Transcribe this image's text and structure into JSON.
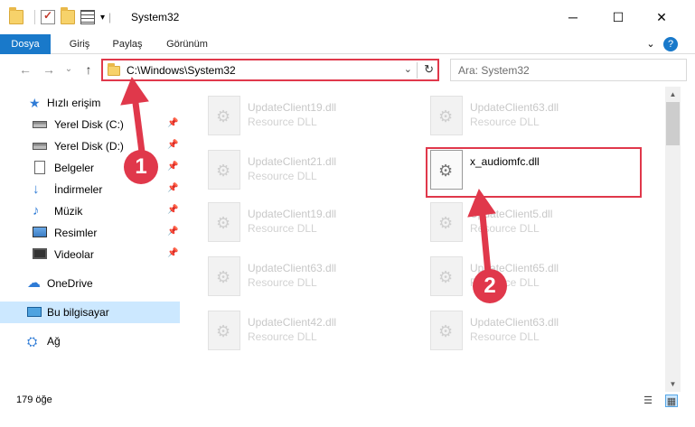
{
  "window": {
    "title": "System32",
    "minimize_glyph": "─",
    "maximize_glyph": "☐",
    "close_glyph": "✕",
    "qa_dropdown_glyph": "▾",
    "qa_separator": "|"
  },
  "ribbon": {
    "tabs": [
      "Dosya",
      "Giriş",
      "Paylaş",
      "Görünüm"
    ],
    "collapse_glyph": "⌄",
    "help_glyph": "?"
  },
  "nav": {
    "back": "←",
    "forward": "→",
    "recent": "⌄",
    "up": "↑",
    "address": "C:\\Windows\\System32",
    "address_dropdown": "⌄",
    "refresh": "↻",
    "search_placeholder": "Ara: System32"
  },
  "sidebar": {
    "pin_glyph": "📌",
    "items": [
      {
        "label": "Hızlı erişim",
        "icon": "star-icon",
        "glyph": "★"
      },
      {
        "label": "Yerel Disk (C:)",
        "icon": "drive-icon",
        "pinned": true
      },
      {
        "label": "Yerel Disk (D:)",
        "icon": "drive-icon",
        "pinned": true
      },
      {
        "label": "Belgeler",
        "icon": "document-icon",
        "pinned": true
      },
      {
        "label": "İndirmeler",
        "icon": "download-icon",
        "glyph": "↓",
        "pinned": true
      },
      {
        "label": "Müzik",
        "icon": "music-icon",
        "glyph": "♪",
        "pinned": true
      },
      {
        "label": "Resimler",
        "icon": "pictures-icon",
        "pinned": true
      },
      {
        "label": "Videolar",
        "icon": "video-icon",
        "pinned": true
      },
      {
        "label": "OneDrive",
        "icon": "cloud-icon",
        "glyph": "☁"
      },
      {
        "label": "Bu bilgisayar",
        "icon": "computer-icon",
        "selected": true
      },
      {
        "label": "Ağ",
        "icon": "network-icon",
        "glyph": "⛭"
      }
    ]
  },
  "files": [
    {
      "name": "UpdateClient19.dll",
      "type": "Resource DLL"
    },
    {
      "name": "UpdateClient63.dll",
      "type": "Resource DLL"
    },
    {
      "name": "UpdateClient21.dll",
      "type": "Resource DLL"
    },
    {
      "name": "x_audiomfc.dll",
      "type": "",
      "highlighted": true
    },
    {
      "name": "UpdateClient19.dll",
      "type": "Resource DLL"
    },
    {
      "name": "UpdateClient5.dll",
      "type": "Resource DLL"
    },
    {
      "name": "UpdateClient63.dll",
      "type": "Resource DLL"
    },
    {
      "name": "UpdateClient65.dll",
      "type": "Resource DLL"
    },
    {
      "name": "UpdateClient42.dll",
      "type": "Resource DLL"
    },
    {
      "name": "UpdateClient63.dll",
      "type": "Resource DLL"
    }
  ],
  "status": {
    "item_count": "179 öğe",
    "details_view_glyph": "☰",
    "large_icons_glyph": "▦"
  },
  "scrollbar": {
    "up": "▲",
    "down": "▼"
  },
  "annotations": {
    "step1": "1",
    "step2": "2",
    "color": "#e0384b"
  }
}
